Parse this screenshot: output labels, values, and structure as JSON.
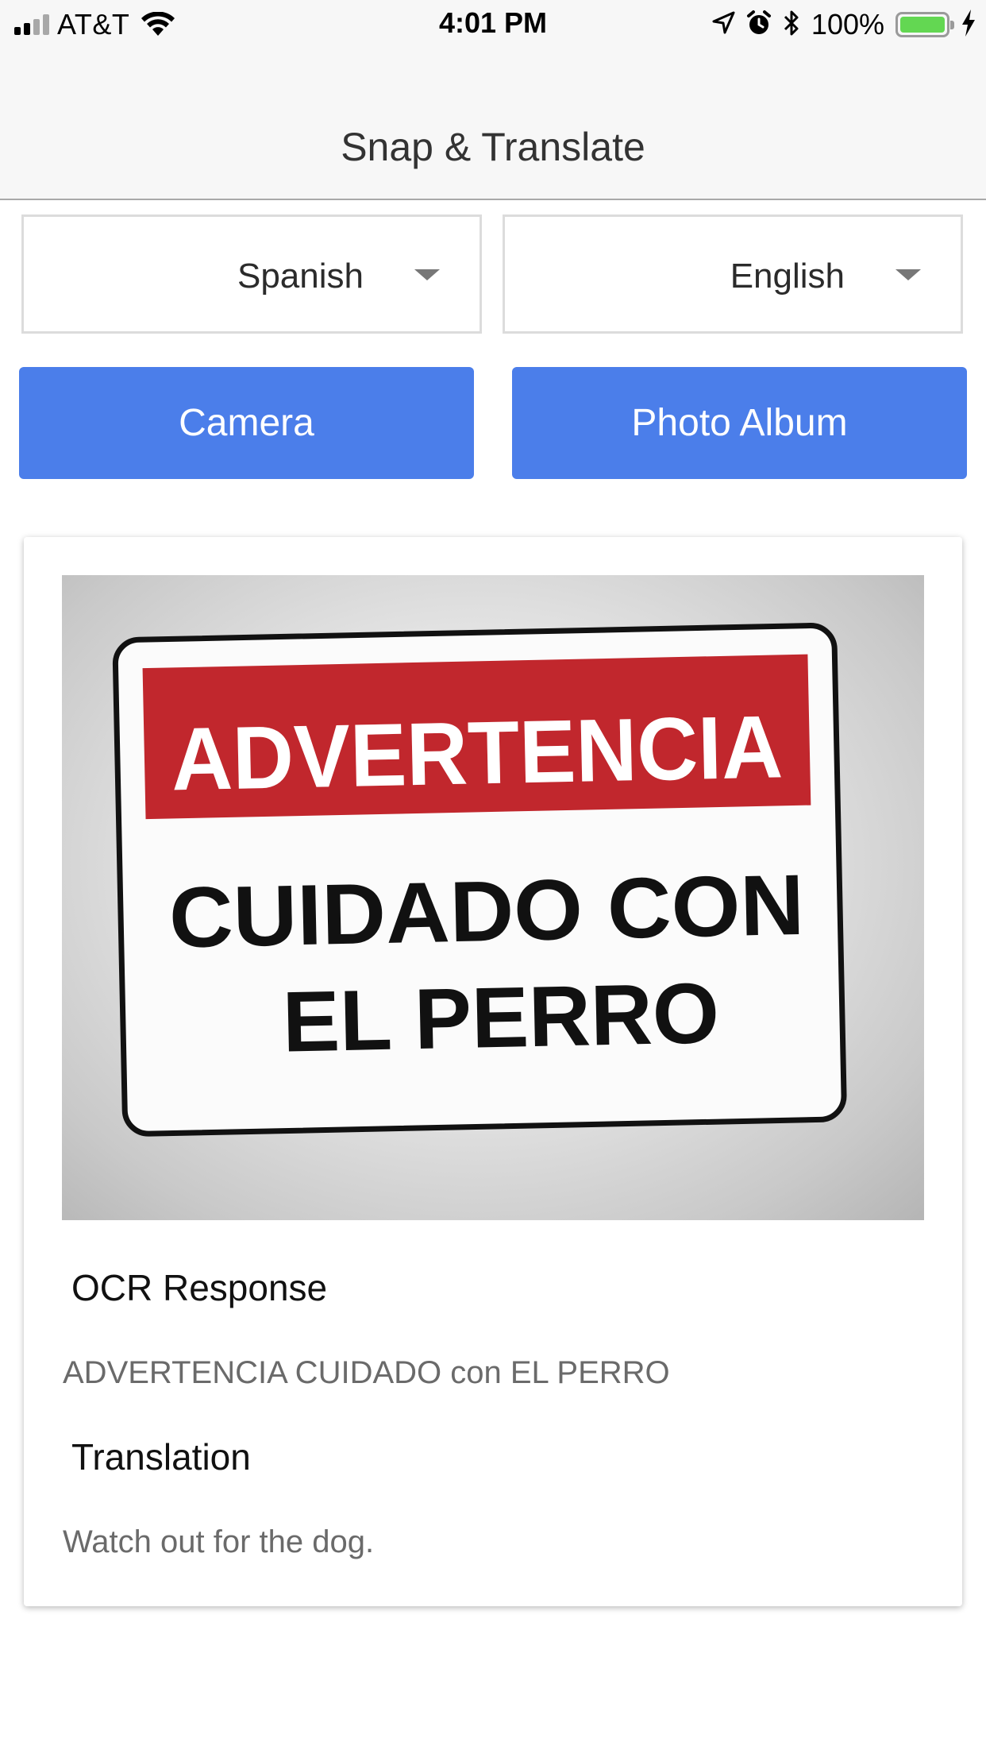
{
  "status_bar": {
    "carrier": "AT&T",
    "time": "4:01 PM",
    "battery_percent": "100%",
    "battery_level": 1.0,
    "signal_bars_active": 2,
    "signal_bars_total": 4,
    "icons": [
      "cellular-signal-icon",
      "wifi-icon",
      "location-arrow-icon",
      "alarm-icon",
      "bluetooth-icon",
      "battery-icon",
      "charging-bolt-icon"
    ]
  },
  "nav": {
    "title": "Snap & Translate"
  },
  "language_picker": {
    "source": "Spanish",
    "target": "English"
  },
  "buttons": {
    "camera": "Camera",
    "photo_album": "Photo Album"
  },
  "colors": {
    "button_blue": "#4b7eea",
    "sign_red": "#c1272d",
    "battery_green": "#63d752"
  },
  "result": {
    "photo": {
      "sign_banner": "ADVERTENCIA",
      "sign_line_1": "CUIDADO CON",
      "sign_line_2": "EL PERRO"
    },
    "ocr_heading": "OCR Response",
    "ocr_text": "ADVERTENCIA CUIDADO con EL PERRO",
    "translation_heading": "Translation",
    "translation_text": "Watch out for the dog."
  }
}
